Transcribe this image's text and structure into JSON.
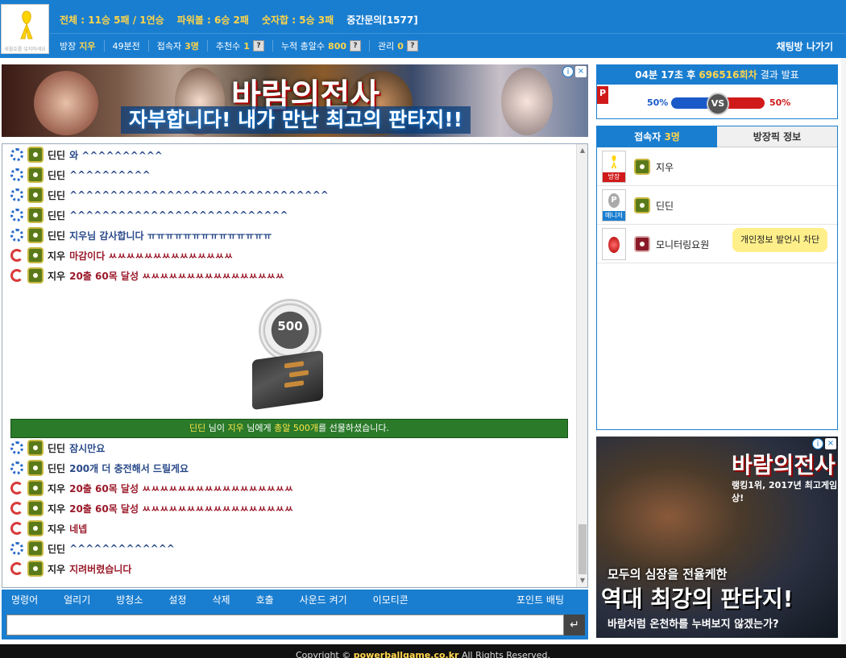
{
  "header": {
    "logo_text": "세월호를 잊지마세요",
    "stats": [
      {
        "label": "전체 : 11승 5패 / 1연승"
      },
      {
        "label": "파워볼 : 6승 2패"
      },
      {
        "label": "숫자합 : 5승 3패"
      },
      {
        "label": "중간문의[1577]"
      }
    ],
    "room_owner_label": "방장",
    "room_owner": "지우",
    "minutes": "49분전",
    "users_label": "접속자",
    "users_count": "3명",
    "recommend_label": "추천수",
    "recommend_count": "1",
    "bullets_label": "누적 총알수",
    "bullets_count": "800",
    "manage_label": "관리",
    "manage_count": "0",
    "help": "?",
    "exit_label": "채팅방 나가기"
  },
  "ad_top": {
    "title": "바람의전사",
    "tagline": "자부합니다! 내가 만난 최고의 판타지!!",
    "info": "i",
    "close": "×"
  },
  "chat": {
    "messages": [
      {
        "name": "딘딘",
        "text": "와 ^^^^^^^^^^",
        "side": "blue"
      },
      {
        "name": "딘딘",
        "text": "^^^^^^^^^^",
        "side": "blue"
      },
      {
        "name": "딘딘",
        "text": "^^^^^^^^^^^^^^^^^^^^^^^^^^^^^^^^",
        "side": "blue"
      },
      {
        "name": "딘딘",
        "text": "^^^^^^^^^^^^^^^^^^^^^^^^^^^",
        "side": "blue"
      },
      {
        "name": "딘딘",
        "text": "지우님 감사합니다 ㅠㅠㅠㅠㅠㅠㅠㅠㅠㅠㅠㅠㅠㅠ",
        "side": "blue"
      },
      {
        "name": "지우",
        "text": "마감이다 ㅆㅆㅆㅆㅆㅆㅆㅆㅆㅆㅆㅆㅆㅆ",
        "side": "red"
      },
      {
        "name": "지우",
        "text": "20출 60목 달성 ㅆㅆㅆㅆㅆㅆㅆㅆㅆㅆㅆㅆㅆㅆㅆㅆ",
        "side": "red"
      }
    ],
    "gift_amount": "500",
    "gift_notice": {
      "from": "딘딘",
      "mid1": " 님이 ",
      "to": "지우",
      "mid2": " 님에게 ",
      "item": "총알 500개",
      "end": "를 선물하셨습니다."
    },
    "messages2": [
      {
        "name": "딘딘",
        "text": "잠시만요",
        "side": "blue"
      },
      {
        "name": "딘딘",
        "text": "200개 더 충전해서 드릴게요",
        "side": "blue"
      },
      {
        "name": "지우",
        "text": "20출 60목 달성 ㅆㅆㅆㅆㅆㅆㅆㅆㅆㅆㅆㅆㅆㅆㅆㅆㅆ",
        "side": "red"
      },
      {
        "name": "지우",
        "text": "20출 60목 달성 ㅆㅆㅆㅆㅆㅆㅆㅆㅆㅆㅆㅆㅆㅆㅆㅆㅆ",
        "side": "red"
      },
      {
        "name": "지우",
        "text": "네넵",
        "side": "red"
      },
      {
        "name": "딘딘",
        "text": "^^^^^^^^^^^^^",
        "side": "blue"
      },
      {
        "name": "지우",
        "text": "지려버렸습니다",
        "side": "red"
      }
    ]
  },
  "commands": [
    "명령어",
    "얼리기",
    "방청소",
    "설정",
    "삭제",
    "호출",
    "사운드 켜기",
    "이모티콘"
  ],
  "point_bet": "포인트 배팅",
  "input": {
    "placeholder": "",
    "send": "↵"
  },
  "footer": {
    "prefix": "Copyright ©",
    "site": "powerballgame.co.kr",
    "suffix": "All Rights Reserved."
  },
  "result": {
    "time": "04분 17초 후",
    "round": "696516회차",
    "label": "결과 발표",
    "flag": "P",
    "left_pct": "50%",
    "right_pct": "50%",
    "vs": "VS"
  },
  "users_panel": {
    "tab_users_prefix": "접속자",
    "tab_users_count": "3명",
    "tab_pick": "방장픽 정보",
    "list": [
      {
        "role": "방장",
        "name": "지우"
      },
      {
        "role": "매니저",
        "name": "딘딘"
      },
      {
        "role": "",
        "name": "모니터링요원"
      }
    ],
    "tooltip": "개인정보 발언시 차단"
  },
  "ad_side": {
    "title": "바람의전사",
    "sub": "랭킹1위, 2017년 최고게임상!",
    "line1": "모두의 심장을 전율케한",
    "line2": "역대 최강의 판타지!",
    "line3": "바람처럼 온천하를 누벼보지 않겠는가?"
  },
  "colors": {
    "primary": "#1a7ed0",
    "accent": "#ffd54a",
    "gift": "#2a7a2a"
  }
}
